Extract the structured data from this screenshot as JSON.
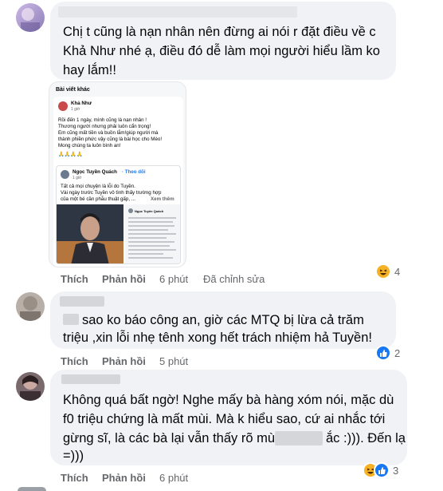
{
  "comments": [
    {
      "text_lines": [
        "Chị t cũng là nạn nhân nên đừng ai nói r đặt điều về c",
        "Khả Như nhé ạ, điều đó dễ làm mọi người hiểu lầm ko",
        "hay lắm!!"
      ],
      "attachment": {
        "header": "Bài viết khác",
        "author": "Khả Như",
        "time": "1 giờ",
        "post_lines": [
          "Rồi đến 1 ngày, mình cũng là nạn nhân !",
          "Thương người nhưng phải luôn cẩn trọng!",
          "Em cũng mất tiền và buồn lắm!giúp người mà",
          "thành phiền phức vậy cũng là bài học cho Mèo!",
          "Mong chúng ta luôn bình an!"
        ],
        "prayer": "🙏🙏🙏🙏",
        "shared_author": "Ngọc Tuyền Quách",
        "follow": "· Theo dõi",
        "shared_time": "1 giờ",
        "shared_lines": [
          "Tất cả mọi chuyện là lỗi do Tuyền.",
          "Vài ngày trước Tuyền vô tình thấy trường hợp",
          "của một bé cần phẫu thuật gấp, ..."
        ],
        "see_more": "Xem thêm",
        "thumb_name": "Ngọc Tuyền Quách"
      },
      "actions": {
        "like": "Thích",
        "reply": "Phản hồi",
        "time": "6 phút",
        "edited": "Đã chỉnh sửa"
      },
      "reaction_count": "4",
      "reaction_icons": [
        "haha-icon"
      ]
    },
    {
      "text_lines": [
        "sao ko báo công an, giờ các MTQ bị lừa cả trăm",
        "triệu ,xin lỗi nhẹ tênh xong hết trách nhiệm hả Tuyền!"
      ],
      "actions": {
        "like": "Thích",
        "reply": "Phản hồi",
        "time": "5 phút"
      },
      "reaction_count": "2",
      "reaction_icons": [
        "like-icon"
      ]
    },
    {
      "text_lines": [
        "Không quá bất ngờ! Nghe mấy bà hàng xóm nói, mặc dù",
        "f0 triệu chứng là mất mùi. Mà k hiểu sao, cứ ai nhắc tới",
        "gừng sĩ, là các bà lại vẫn thấy rõ mùi",
        "ắc :))). Đến lạ",
        "=)))"
      ],
      "actions": {
        "like": "Thích",
        "reply": "Phản hồi",
        "time": "6 phút"
      },
      "reaction_count": "3",
      "reaction_icons": [
        "haha-icon",
        "like-icon"
      ]
    }
  ],
  "colors": {
    "bubble": "#f0f2f5",
    "meta_text": "#65676b",
    "link": "#1877f2",
    "haha": "#f7b125",
    "like": "#1877f2"
  }
}
